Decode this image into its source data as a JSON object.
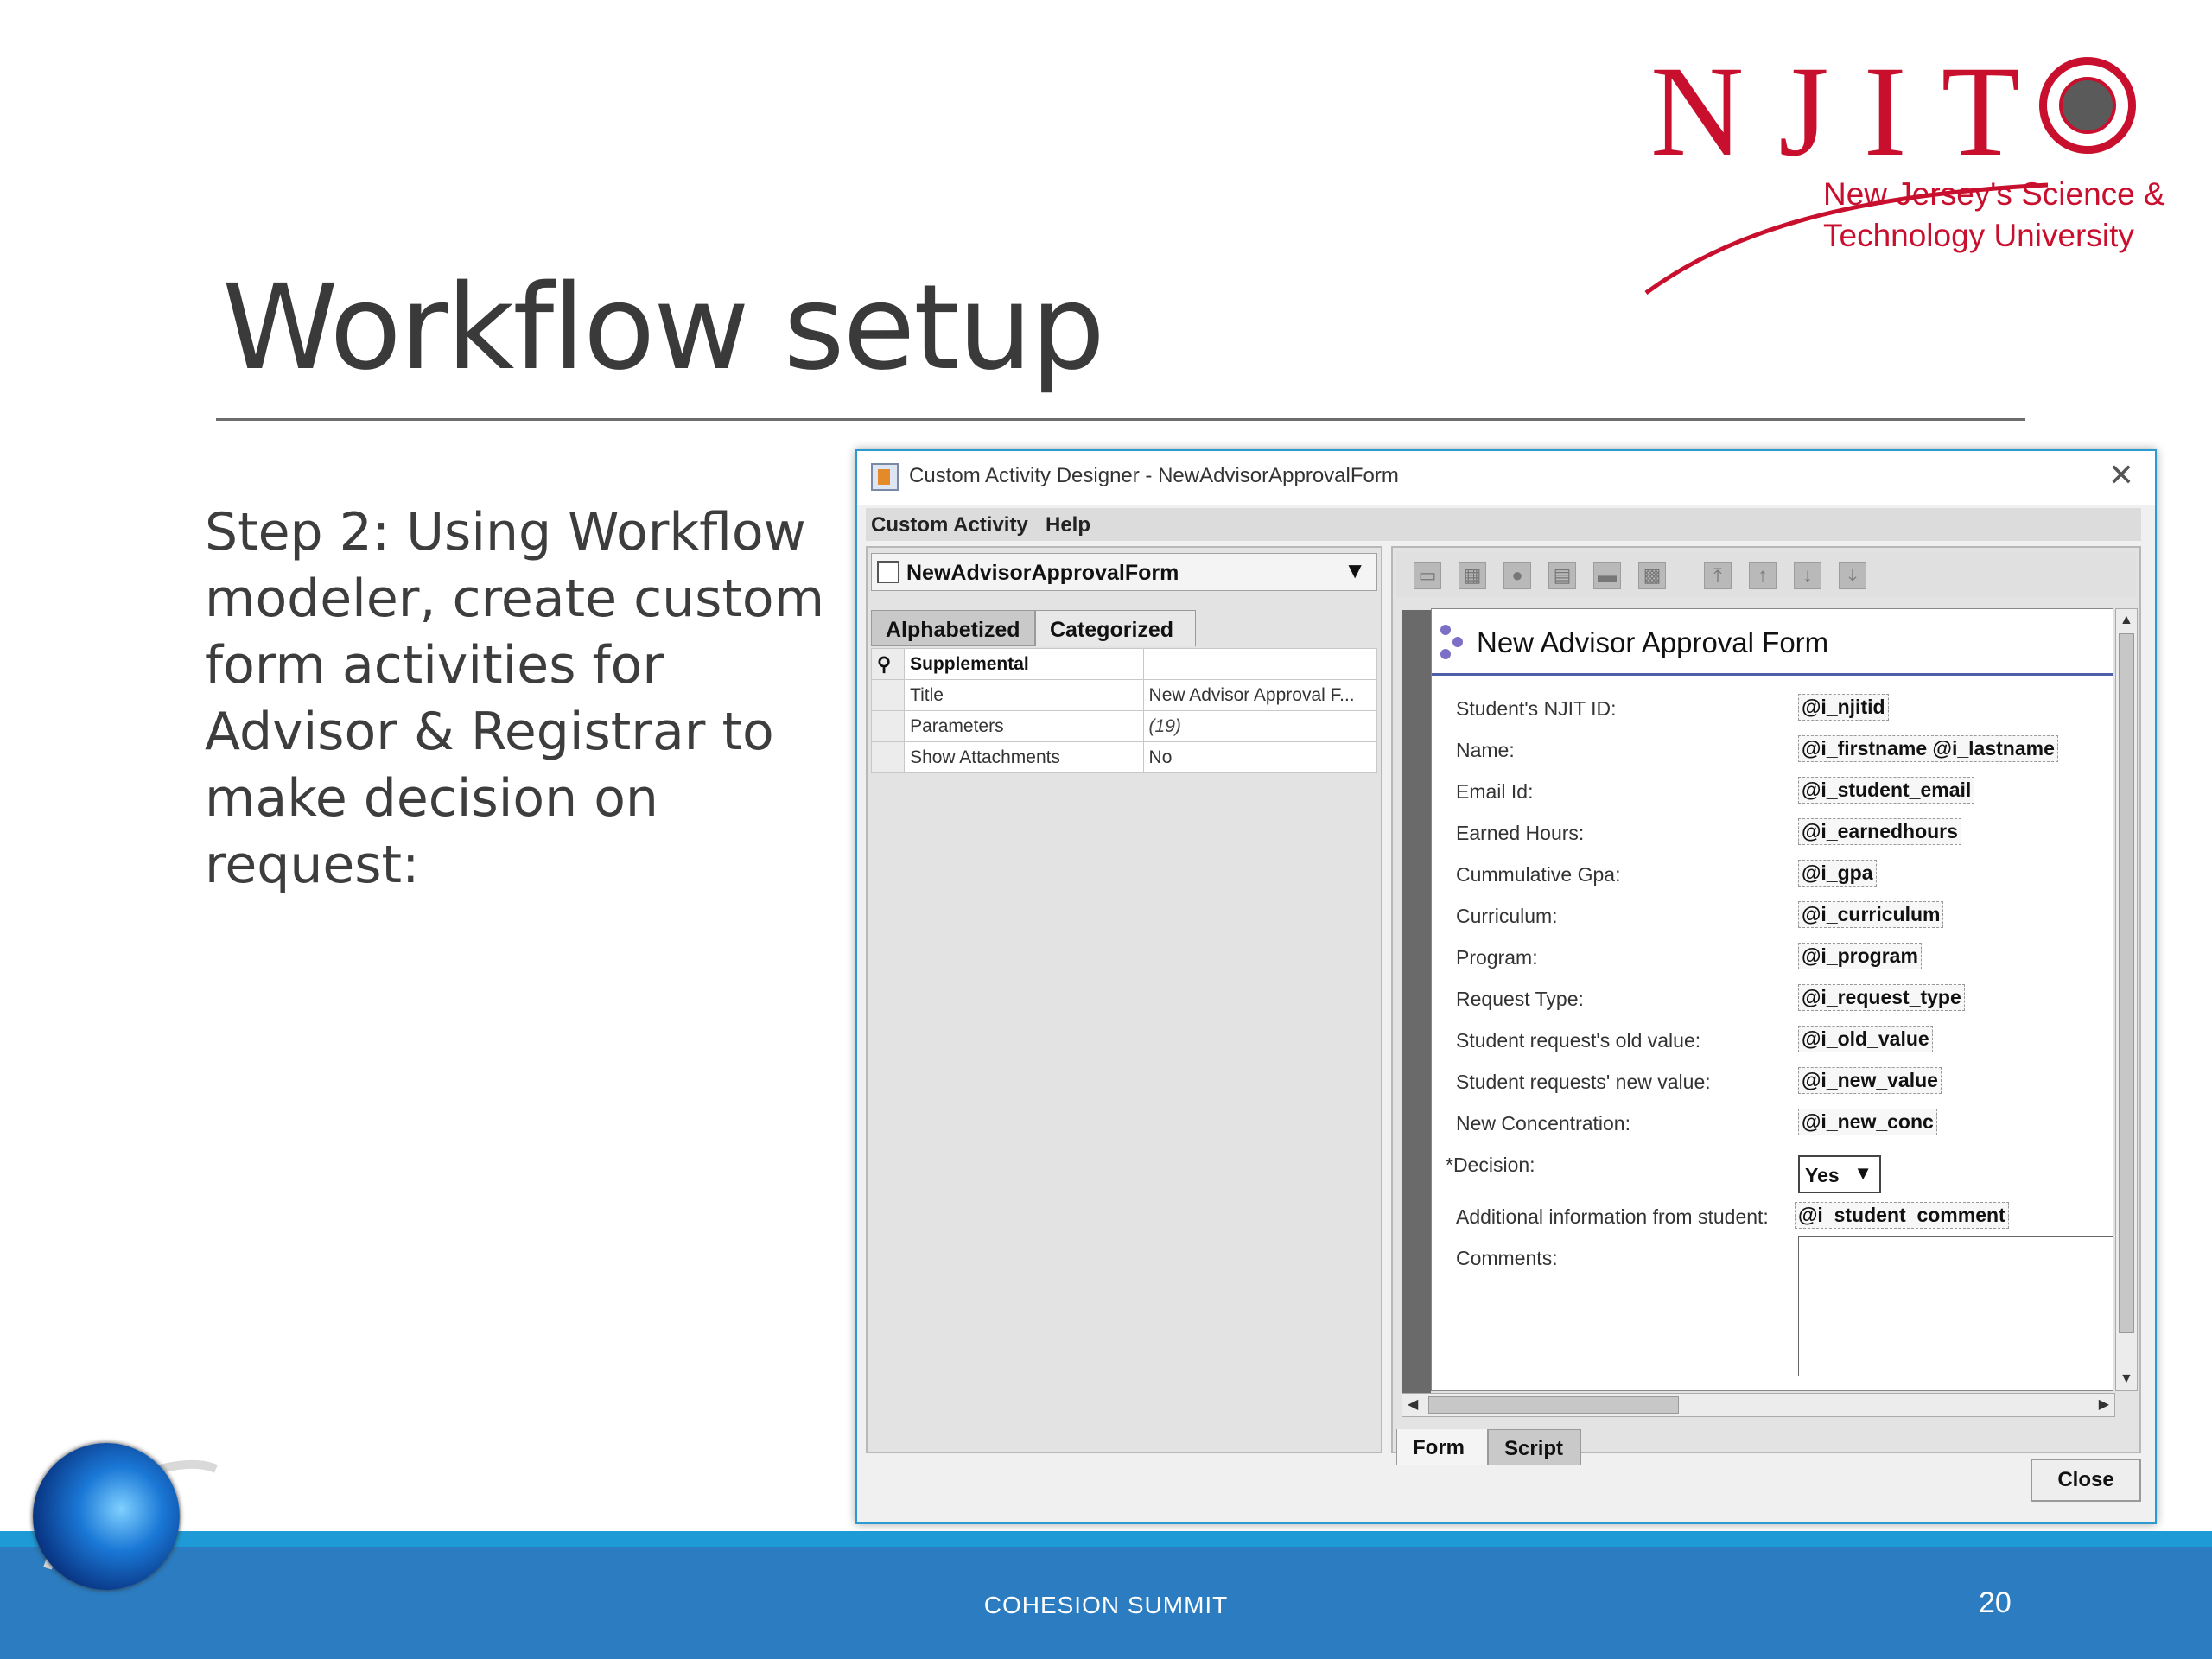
{
  "slide": {
    "title": "Workflow setup",
    "step_text": "Step 2: Using Workflow modeler, create custom form activities for Advisor & Registrar to make decision on request:",
    "footer": "COHESION SUMMIT",
    "page_number": "20"
  },
  "logo": {
    "letters": "NJIT",
    "line1": "New Jersey's Science &",
    "line2": "Technology University",
    "color": "#c8102e"
  },
  "window": {
    "title": "Custom Activity Designer - NewAdvisorApprovalForm",
    "close_glyph": "✕",
    "menu": [
      "Custom Activity",
      "Help"
    ],
    "combo_value": "NewAdvisorApprovalForm",
    "combo_arrow": "▼",
    "tabs": {
      "alphabetized": "Alphabetized",
      "categorized": "Categorized"
    },
    "properties": {
      "category": "Supplemental",
      "rows": [
        {
          "name": "Title",
          "value": "New Advisor Approval F..."
        },
        {
          "name": "Parameters",
          "value": "(19)"
        },
        {
          "name": "Show Attachments",
          "value": "No"
        }
      ]
    },
    "toolbar_icons": [
      "textbox-icon",
      "textarea-icon",
      "radio-icon",
      "listbox-icon",
      "button-icon",
      "grid-icon",
      "move-top-icon",
      "move-up-icon",
      "move-down-icon",
      "move-bottom-icon"
    ],
    "form": {
      "title": "New Advisor Approval Form",
      "fields": [
        {
          "label": "Student's NJIT ID:",
          "value": "@i_njitid"
        },
        {
          "label": "Name:",
          "value": "@i_firstname @i_lastname"
        },
        {
          "label": "Email Id:",
          "value": "@i_student_email"
        },
        {
          "label": "Earned Hours:",
          "value": "@i_earnedhours"
        },
        {
          "label": "Cummulative Gpa:",
          "value": "@i_gpa"
        },
        {
          "label": "Curriculum:",
          "value": "@i_curriculum"
        },
        {
          "label": "Program:",
          "value": "@i_program"
        },
        {
          "label": "Request Type:",
          "value": "@i_request_type"
        },
        {
          "label": "Student request's old value:",
          "value": "@i_old_value"
        },
        {
          "label": "Student requests' new value:",
          "value": "@i_new_value"
        },
        {
          "label": "New Concentration:",
          "value": "@i_new_conc"
        }
      ],
      "decision_label": "*Decision:",
      "decision_value": "Yes",
      "additional_label": "Additional information from student:",
      "additional_value": "@i_student_comment",
      "comments_label": "Comments:"
    },
    "bottom_tabs": {
      "form": "Form",
      "script": "Script"
    },
    "close_button": "Close"
  },
  "colors": {
    "footer_band": "#2b7cc0",
    "footer_stripe": "#1e9bd7",
    "window_border": "#2a9ad0",
    "form_rule": "#4d5fa8"
  }
}
